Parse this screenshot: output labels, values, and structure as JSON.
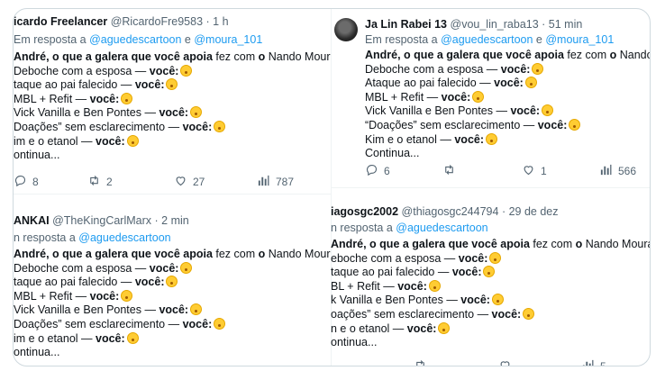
{
  "tweets": [
    {
      "name": "icardo Freelancer",
      "handle": "@RicardoFre9583",
      "time": "· 1 h",
      "reply_prefix": "Em resposta a",
      "mention1": "@aguedescartoon",
      "reply_and": "e",
      "mention2": "@moura_101",
      "lines": [
        [
          "André, o que a galera que você apoia",
          " fez com ",
          "o",
          " Nando Moura:",
          ""
        ],
        [
          "Deboche com a esposa — ",
          "você:",
          ""
        ],
        [
          "taque ao pai falecido — ",
          "você:",
          ""
        ],
        [
          "MBL + Refit — ",
          "você:",
          ""
        ],
        [
          "Vick Vanilla e Ben Pontes — ",
          "você:",
          ""
        ],
        [
          "Doações” sem esclarecimento — ",
          "você:",
          ""
        ],
        [
          "im e o etanol — ",
          "você:",
          ""
        ],
        [
          "ontinua...",
          "",
          ""
        ]
      ],
      "replies": "8",
      "retweets": "2",
      "likes": "27",
      "views": "787"
    },
    {
      "name": "Ja Lin Rabei 13",
      "handle": "@vou_lin_raba13",
      "time": "· 51 min",
      "reply_prefix": "Em resposta a",
      "mention1": "@aguedescartoon",
      "reply_and": "e",
      "mention2": "@moura_101",
      "lines": [
        [
          "André, o que a galera que você apoia",
          " fez com ",
          "o",
          " Nando Moura:",
          ""
        ],
        [
          "Deboche com a esposa — ",
          "você:",
          ""
        ],
        [
          "Ataque ao pai falecido — ",
          "você:",
          ""
        ],
        [
          "MBL + Refit — ",
          "você:",
          ""
        ],
        [
          "Vick Vanilla e Ben Pontes — ",
          "você:",
          ""
        ],
        [
          "“Doações” sem esclarecimento — ",
          "você:",
          ""
        ],
        [
          "Kim e o etanol — ",
          "você:",
          ""
        ],
        [
          "Continua...",
          "",
          ""
        ]
      ],
      "replies": "6",
      "retweets": "",
      "likes": "1",
      "views": "566"
    },
    {
      "name": "ANKAI",
      "handle": "@TheKingCarlMarx",
      "time": "· 2 min",
      "reply_prefix": "n resposta a",
      "mention1": "@aguedescartoon",
      "lines": [
        [
          "André, o que a galera que você apoia",
          " fez com ",
          "o",
          " Nando Moura:",
          ""
        ],
        [
          "Deboche com a esposa — ",
          "você:",
          ""
        ],
        [
          "taque ao pai falecido — ",
          "você:",
          ""
        ],
        [
          "MBL + Refit — ",
          "você:",
          ""
        ],
        [
          "Vick Vanilla e Ben Pontes — ",
          "você:",
          ""
        ],
        [
          "Doações” sem esclarecimento — ",
          "você:",
          ""
        ],
        [
          "im e o etanol — ",
          "você:",
          ""
        ],
        [
          "ontinua...",
          "",
          ""
        ]
      ]
    },
    {
      "name": "iagosgc2002",
      "handle": "@thiagosgc244794",
      "time": "· 29 de dez",
      "reply_prefix": "n resposta a",
      "mention1": "@aguedescartoon",
      "lines": [
        [
          "André, o que a galera que você apoia",
          " fez com ",
          "o",
          " Nando Moura:",
          ""
        ],
        [
          "eboche com a esposa — ",
          "você:",
          ""
        ],
        [
          "taque ao pai falecido — ",
          "você:",
          ""
        ],
        [
          "BL + Refit — ",
          "você:",
          ""
        ],
        [
          "k Vanilla e Ben Pontes — ",
          "você:",
          ""
        ],
        [
          "oações” sem esclarecimento — ",
          "você:",
          ""
        ],
        [
          "n e o etanol — ",
          "você:",
          ""
        ],
        [
          "ontinua...",
          "",
          ""
        ]
      ],
      "replies": "",
      "retweets": "",
      "likes": "",
      "views": "5"
    }
  ]
}
